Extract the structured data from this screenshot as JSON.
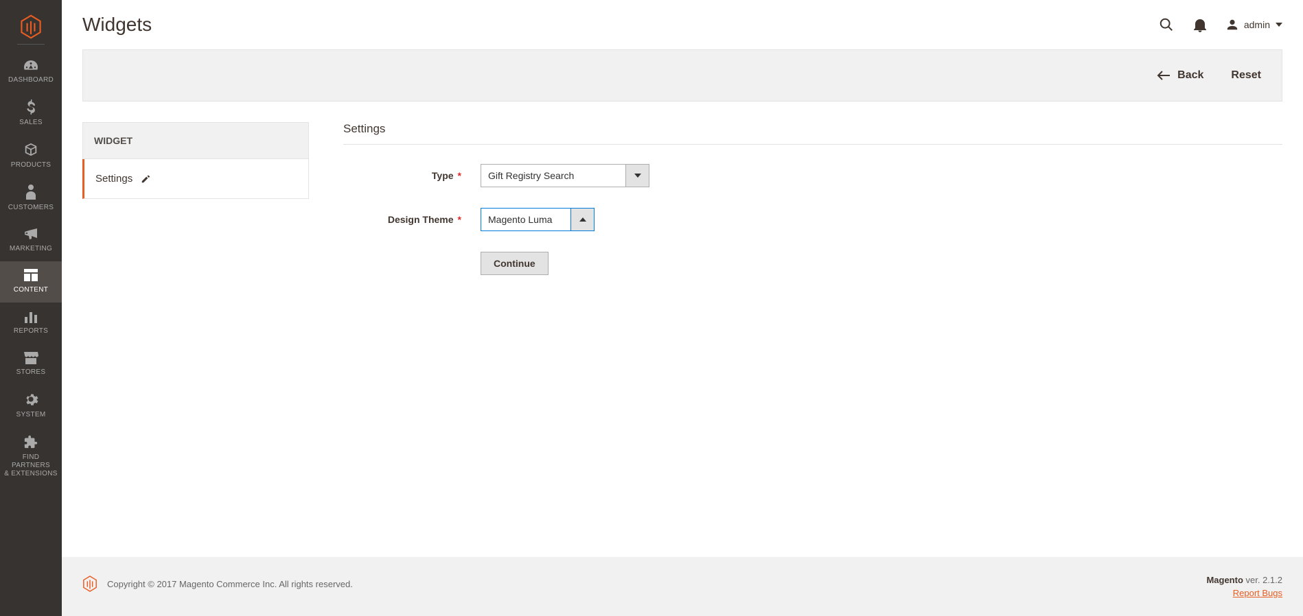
{
  "sidebar": {
    "items": [
      {
        "label": "DASHBOARD"
      },
      {
        "label": "SALES"
      },
      {
        "label": "PRODUCTS"
      },
      {
        "label": "CUSTOMERS"
      },
      {
        "label": "MARKETING"
      },
      {
        "label": "CONTENT"
      },
      {
        "label": "REPORTS"
      },
      {
        "label": "STORES"
      },
      {
        "label": "SYSTEM"
      },
      {
        "label": "FIND PARTNERS\n& EXTENSIONS"
      }
    ]
  },
  "header": {
    "title": "Widgets",
    "account_label": "admin"
  },
  "toolbar": {
    "back_label": "Back",
    "reset_label": "Reset"
  },
  "tabs": {
    "header": "WIDGET",
    "items": [
      {
        "label": "Settings"
      }
    ]
  },
  "form": {
    "section_title": "Settings",
    "type_label": "Type",
    "type_value": "Gift Registry Search",
    "theme_label": "Design Theme",
    "theme_value": "Magento Luma",
    "continue_label": "Continue"
  },
  "footer": {
    "copyright": "Copyright © 2017 Magento Commerce Inc. All rights reserved.",
    "product": "Magento",
    "version": " ver. 2.1.2",
    "report_bugs": "Report Bugs"
  }
}
